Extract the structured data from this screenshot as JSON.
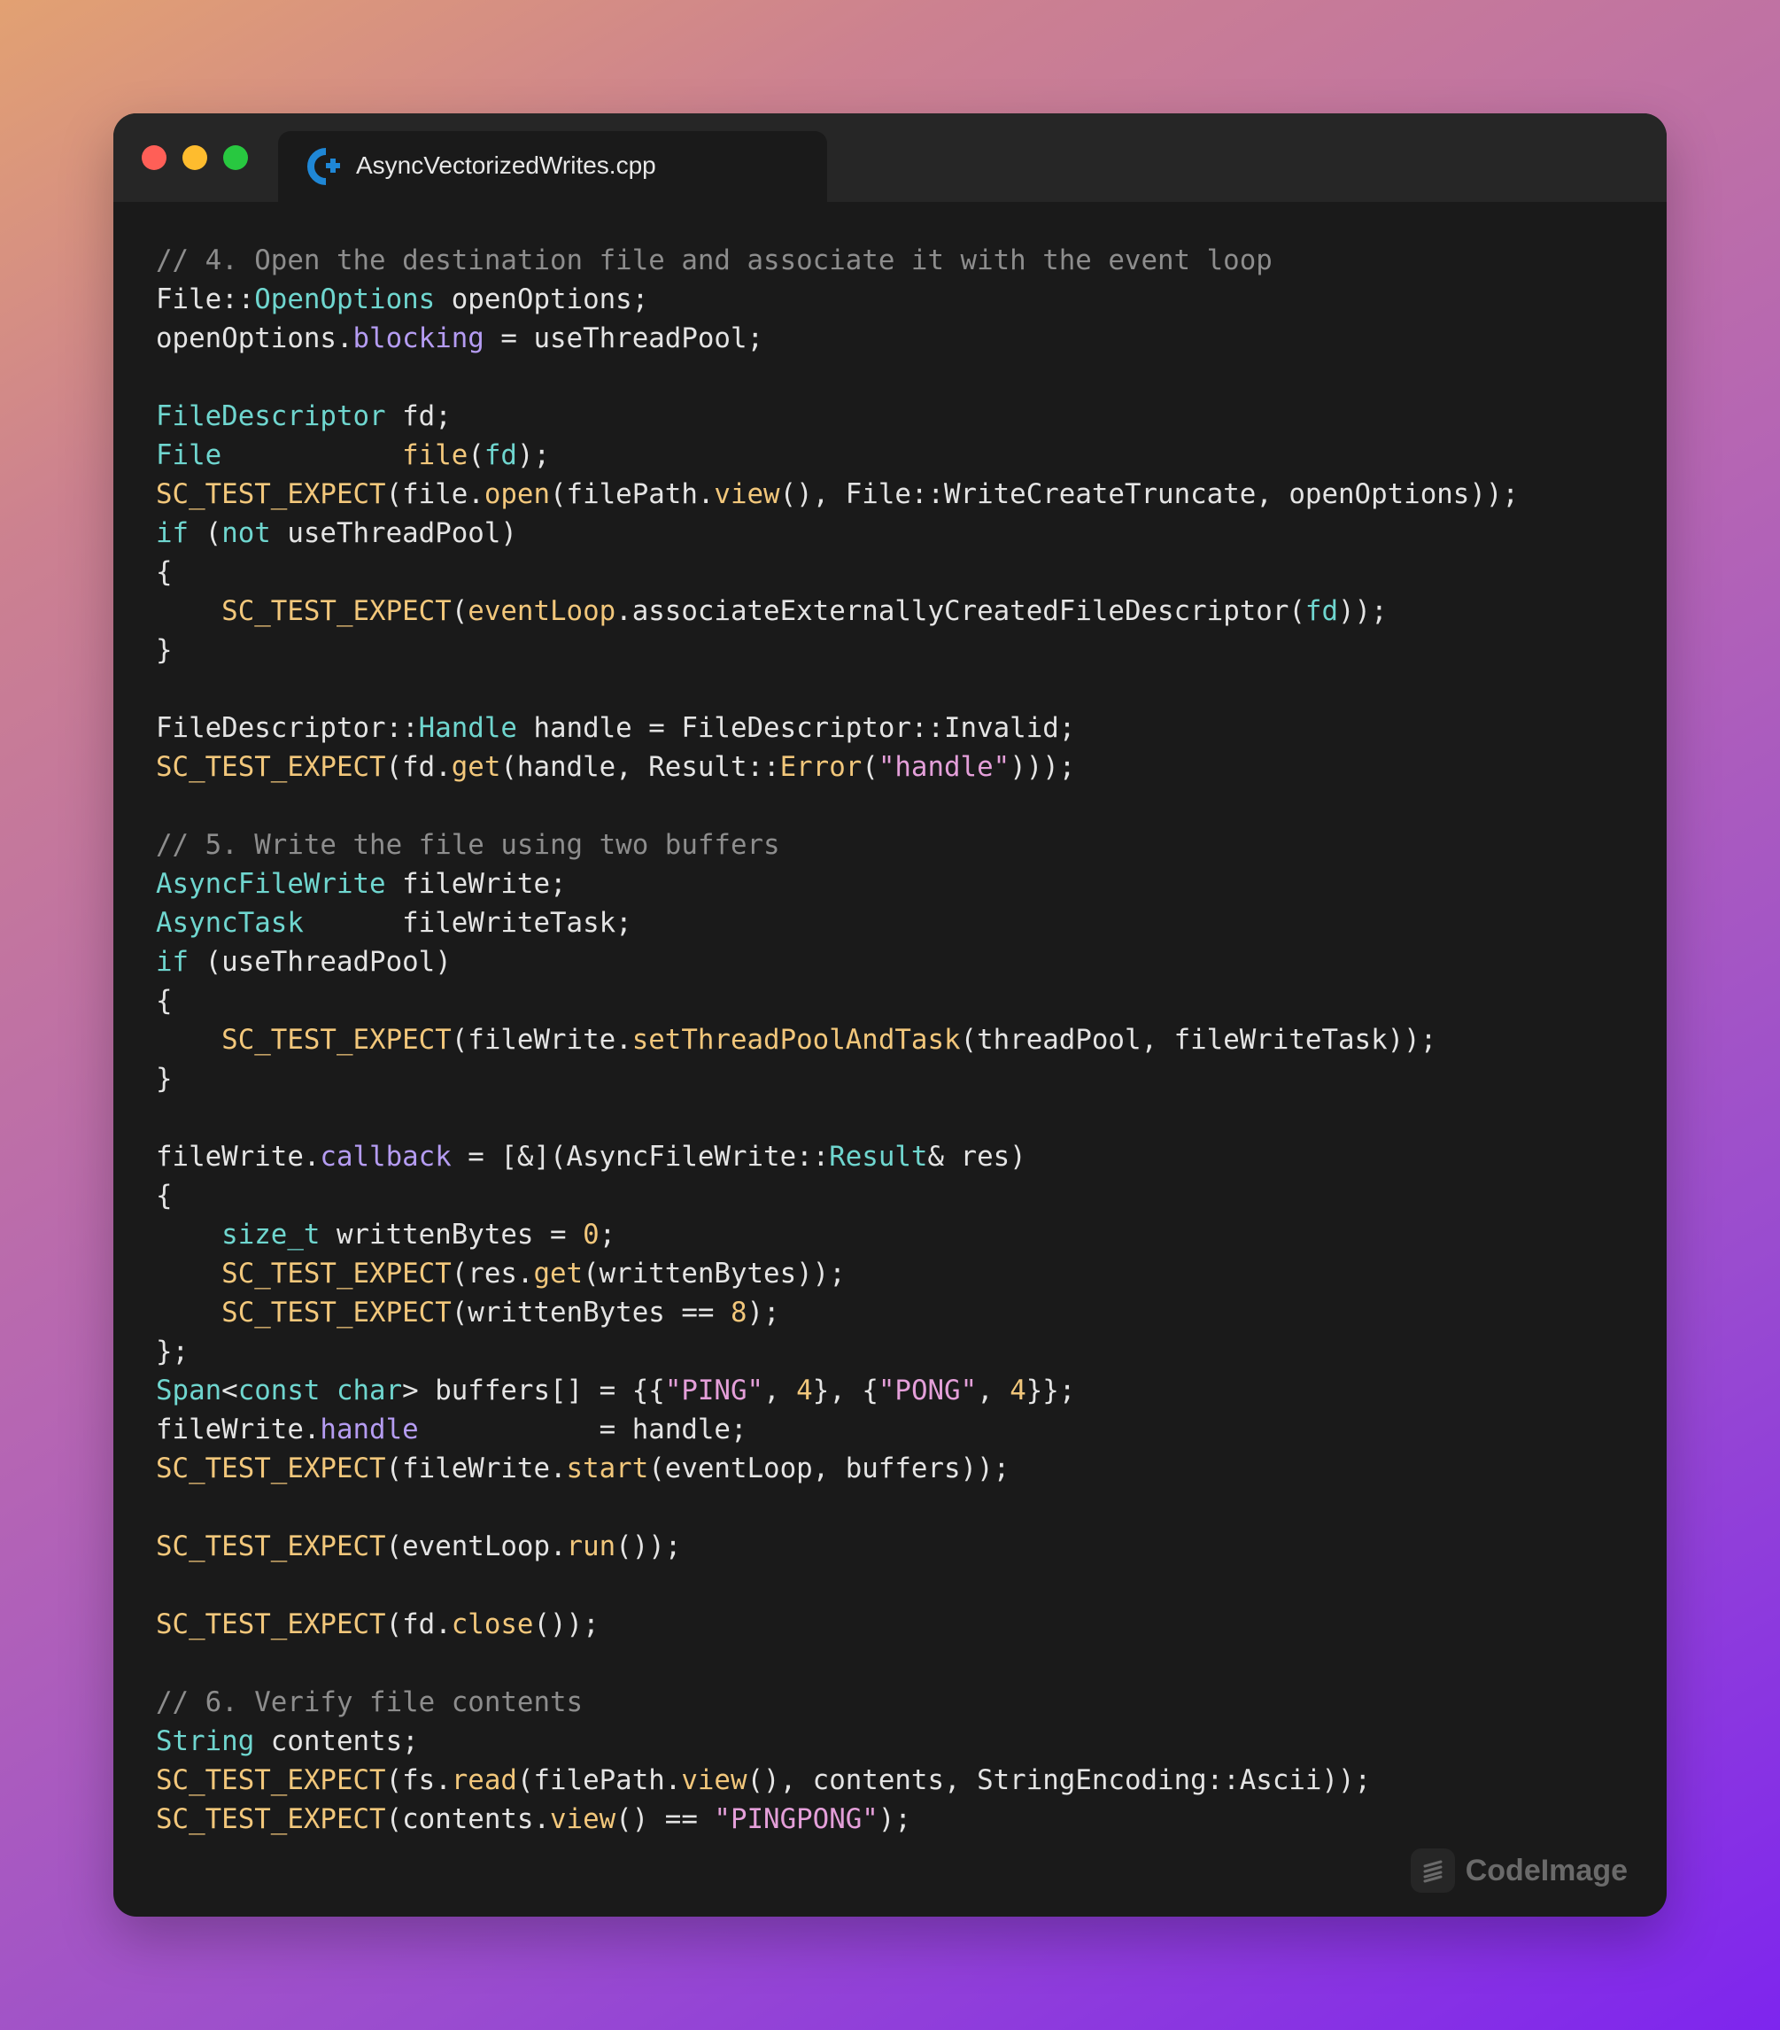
{
  "window": {
    "tab": {
      "file_name": "AsyncVectorizedWrites.cpp",
      "icon": "cpp-file-icon"
    },
    "controls": [
      "close",
      "minimize",
      "maximize"
    ]
  },
  "code_lines": [
    [
      [
        "comment",
        "// 4. Open the destination file and associate it with the event loop"
      ]
    ],
    [
      [
        "plain",
        "File::"
      ],
      [
        "type",
        "OpenOptions"
      ],
      [
        "plain",
        " openOptions;"
      ]
    ],
    [
      [
        "plain",
        "openOptions."
      ],
      [
        "prop",
        "blocking"
      ],
      [
        "plain",
        " = useThreadPool;"
      ]
    ],
    [],
    [
      [
        "type",
        "FileDescriptor"
      ],
      [
        "plain",
        " fd;"
      ]
    ],
    [
      [
        "type",
        "File"
      ],
      [
        "plain",
        "           "
      ],
      [
        "func",
        "file"
      ],
      [
        "plain",
        "("
      ],
      [
        "type",
        "fd"
      ],
      [
        "plain",
        ");"
      ]
    ],
    [
      [
        "func",
        "SC_TEST_EXPECT"
      ],
      [
        "plain",
        "(file."
      ],
      [
        "func",
        "open"
      ],
      [
        "plain",
        "(filePath."
      ],
      [
        "func",
        "view"
      ],
      [
        "plain",
        "(), File::WriteCreateTruncate, openOptions));"
      ]
    ],
    [
      [
        "kw",
        "if"
      ],
      [
        "plain",
        " ("
      ],
      [
        "kw",
        "not"
      ],
      [
        "plain",
        " useThreadPool)"
      ]
    ],
    [
      [
        "plain",
        "{"
      ]
    ],
    [
      [
        "plain",
        "    "
      ],
      [
        "func",
        "SC_TEST_EXPECT"
      ],
      [
        "plain",
        "("
      ],
      [
        "func",
        "eventLoop"
      ],
      [
        "plain",
        ".associateExternallyCreatedFileDescriptor("
      ],
      [
        "type",
        "fd"
      ],
      [
        "plain",
        "));"
      ]
    ],
    [
      [
        "plain",
        "}"
      ]
    ],
    [],
    [
      [
        "plain",
        "FileDescriptor::"
      ],
      [
        "type",
        "Handle"
      ],
      [
        "plain",
        " handle = FileDescriptor::Invalid;"
      ]
    ],
    [
      [
        "func",
        "SC_TEST_EXPECT"
      ],
      [
        "plain",
        "(fd."
      ],
      [
        "func",
        "get"
      ],
      [
        "plain",
        "(handle, Result::"
      ],
      [
        "func",
        "Error"
      ],
      [
        "plain",
        "("
      ],
      [
        "str",
        "\"handle\""
      ],
      [
        "plain",
        ")));"
      ]
    ],
    [],
    [
      [
        "comment",
        "// 5. Write the file using two buffers"
      ]
    ],
    [
      [
        "type",
        "AsyncFileWrite"
      ],
      [
        "plain",
        " fileWrite;"
      ]
    ],
    [
      [
        "type",
        "AsyncTask"
      ],
      [
        "plain",
        "      fileWriteTask;"
      ]
    ],
    [
      [
        "kw",
        "if"
      ],
      [
        "plain",
        " (useThreadPool)"
      ]
    ],
    [
      [
        "plain",
        "{"
      ]
    ],
    [
      [
        "plain",
        "    "
      ],
      [
        "func",
        "SC_TEST_EXPECT"
      ],
      [
        "plain",
        "(fileWrite."
      ],
      [
        "func",
        "setThreadPoolAndTask"
      ],
      [
        "plain",
        "(threadPool, fileWriteTask));"
      ]
    ],
    [
      [
        "plain",
        "}"
      ]
    ],
    [],
    [
      [
        "plain",
        "fileWrite."
      ],
      [
        "prop",
        "callback"
      ],
      [
        "plain",
        " = [&](AsyncFileWrite::"
      ],
      [
        "type",
        "Result"
      ],
      [
        "plain",
        "& res)"
      ]
    ],
    [
      [
        "plain",
        "{"
      ]
    ],
    [
      [
        "plain",
        "    "
      ],
      [
        "type",
        "size_t"
      ],
      [
        "plain",
        " writtenBytes = "
      ],
      [
        "num",
        "0"
      ],
      [
        "plain",
        ";"
      ]
    ],
    [
      [
        "plain",
        "    "
      ],
      [
        "func",
        "SC_TEST_EXPECT"
      ],
      [
        "plain",
        "(res."
      ],
      [
        "func",
        "get"
      ],
      [
        "plain",
        "(writtenBytes));"
      ]
    ],
    [
      [
        "plain",
        "    "
      ],
      [
        "func",
        "SC_TEST_EXPECT"
      ],
      [
        "plain",
        "(writtenBytes == "
      ],
      [
        "num",
        "8"
      ],
      [
        "plain",
        ");"
      ]
    ],
    [
      [
        "plain",
        "};"
      ]
    ],
    [
      [
        "type",
        "Span"
      ],
      [
        "plain",
        "<"
      ],
      [
        "type",
        "const char"
      ],
      [
        "plain",
        "> buffers[] = {{"
      ],
      [
        "str",
        "\"PING\""
      ],
      [
        "plain",
        ", "
      ],
      [
        "num",
        "4"
      ],
      [
        "plain",
        "}, {"
      ],
      [
        "str",
        "\"PONG\""
      ],
      [
        "plain",
        ", "
      ],
      [
        "num",
        "4"
      ],
      [
        "plain",
        "}};"
      ]
    ],
    [
      [
        "plain",
        "fileWrite."
      ],
      [
        "prop",
        "handle"
      ],
      [
        "plain",
        "           = handle;"
      ]
    ],
    [
      [
        "func",
        "SC_TEST_EXPECT"
      ],
      [
        "plain",
        "(fileWrite."
      ],
      [
        "func",
        "start"
      ],
      [
        "plain",
        "(eventLoop, buffers));"
      ]
    ],
    [],
    [
      [
        "func",
        "SC_TEST_EXPECT"
      ],
      [
        "plain",
        "(eventLoop."
      ],
      [
        "func",
        "run"
      ],
      [
        "plain",
        "());"
      ]
    ],
    [],
    [
      [
        "func",
        "SC_TEST_EXPECT"
      ],
      [
        "plain",
        "(fd."
      ],
      [
        "func",
        "close"
      ],
      [
        "plain",
        "());"
      ]
    ],
    [],
    [
      [
        "comment",
        "// 6. Verify file contents"
      ]
    ],
    [
      [
        "type",
        "String"
      ],
      [
        "plain",
        " contents;"
      ]
    ],
    [
      [
        "func",
        "SC_TEST_EXPECT"
      ],
      [
        "plain",
        "(fs."
      ],
      [
        "func",
        "read"
      ],
      [
        "plain",
        "(filePath."
      ],
      [
        "func",
        "view"
      ],
      [
        "plain",
        "(), contents, StringEncoding::Ascii));"
      ]
    ],
    [
      [
        "func",
        "SC_TEST_EXPECT"
      ],
      [
        "plain",
        "(contents."
      ],
      [
        "func",
        "view"
      ],
      [
        "plain",
        "() == "
      ],
      [
        "str",
        "\"PINGPONG\""
      ],
      [
        "plain",
        ");"
      ]
    ]
  ],
  "watermark": {
    "label": "CodeImage",
    "icon": "codeimage-logo-icon"
  },
  "colors": {
    "window_bg": "#1a1a1a",
    "titlebar_bg": "#262626",
    "comment": "#8d8d8d",
    "type": "#6fd6cf",
    "function": "#f2c77b",
    "property": "#b59cf2",
    "string": "#e49fd9",
    "number": "#f2c77b",
    "plain": "#e4e4e4"
  }
}
